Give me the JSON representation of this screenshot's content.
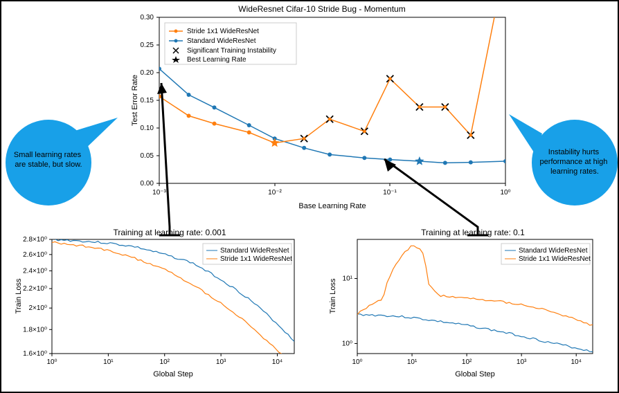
{
  "main": {
    "title": "WideResnet Cifar-10 Stride Bug - Momentum",
    "xlabel": "Base Learning Rate",
    "ylabel": "Test Error Rate",
    "legend": {
      "s1": "Stride 1x1 WideResNet",
      "s2": "Standard WideResNet",
      "m1": "Significant Training Instability",
      "m2": "Best Learning Rate"
    },
    "yticks": [
      "0.00",
      "0.05",
      "0.10",
      "0.15",
      "0.20",
      "0.25",
      "0.30"
    ],
    "xticks": [
      "10⁻³",
      "10⁻²",
      "10⁻¹",
      "10⁰"
    ]
  },
  "bl": {
    "title": "Training at learning rate: 0.001",
    "xlabel": "Global Step",
    "ylabel": "Train Loss",
    "legend": {
      "s1": "Standard WideResNet",
      "s2": "Stride 1x1 WideResNet"
    },
    "xticks": [
      "10⁰",
      "10¹",
      "10²",
      "10³",
      "10⁴"
    ],
    "yticks": [
      "1.6×10⁰",
      "1.8×10⁰",
      "2×10⁰",
      "2.2×10⁰",
      "2.4×10⁰",
      "2.6×10⁰",
      "2.8×10⁰"
    ]
  },
  "br": {
    "title": "Training at learning rate: 0.1",
    "xlabel": "Global Step",
    "ylabel": "Train Loss",
    "legend": {
      "s1": "Standard WideResNet",
      "s2": "Stride 1x1 WideResNet"
    },
    "xticks": [
      "10⁰",
      "10¹",
      "10²",
      "10³",
      "10⁴"
    ],
    "yticks": [
      "10⁰",
      "10¹"
    ]
  },
  "ann": {
    "left": "Small learning rates\nare stable, but slow.",
    "right": "Instability hurts\nperformance at high\nlearning rates."
  },
  "chart_data": [
    {
      "type": "line",
      "id": "main",
      "title": "WideResnet Cifar-10 Stride Bug - Momentum",
      "xlabel": "Base Learning Rate",
      "ylabel": "Test Error Rate",
      "xscale": "log",
      "xlim": [
        0.001,
        1.0
      ],
      "ylim": [
        0.0,
        0.3
      ],
      "x": [
        0.001,
        0.0018,
        0.003,
        0.006,
        0.01,
        0.018,
        0.03,
        0.06,
        0.1,
        0.18,
        0.3,
        0.5,
        1.0
      ],
      "series": [
        {
          "name": "Stride 1x1 WideResNet",
          "values": [
            0.157,
            0.122,
            0.108,
            0.092,
            0.073,
            0.081,
            0.116,
            0.094,
            0.189,
            0.138,
            0.138,
            0.087,
            0.4
          ],
          "color": "#ff7f0e",
          "markers": [
            "dot",
            "dot",
            "dot",
            "dot",
            "star",
            "x",
            "x",
            "x",
            "x",
            "x",
            "x",
            "x",
            "off"
          ]
        },
        {
          "name": "Standard WideResNet",
          "values": [
            0.207,
            0.16,
            0.137,
            0.105,
            0.081,
            0.064,
            0.052,
            0.046,
            0.043,
            0.04,
            0.037,
            0.038,
            0.04
          ],
          "color": "#1f77b4",
          "markers": [
            "dot",
            "dot",
            "dot",
            "dot",
            "dot",
            "dot",
            "dot",
            "dot",
            "dot",
            "star",
            "dot",
            "dot",
            "dot"
          ]
        }
      ],
      "annotations": [
        "X = Significant Training Instability",
        "★ = Best Learning Rate"
      ]
    },
    {
      "type": "line",
      "id": "bottom_left",
      "title": "Training at learning rate: 0.001",
      "xlabel": "Global Step",
      "ylabel": "Train Loss",
      "xscale": "log",
      "yscale": "log",
      "xlim": [
        1,
        20000
      ],
      "ylim": [
        1.6,
        2.8
      ],
      "x": [
        1,
        3,
        10,
        30,
        100,
        300,
        1000,
        3000,
        10000,
        20000
      ],
      "series": [
        {
          "name": "Standard WideResNet",
          "values": [
            2.8,
            2.78,
            2.75,
            2.7,
            2.6,
            2.5,
            2.3,
            2.1,
            1.85,
            1.7
          ],
          "color": "#1f77b4"
        },
        {
          "name": "Stride 1x1 WideResNet",
          "values": [
            2.76,
            2.72,
            2.65,
            2.55,
            2.42,
            2.25,
            2.05,
            1.85,
            1.62,
            1.52
          ],
          "color": "#ff7f0e"
        }
      ]
    },
    {
      "type": "line",
      "id": "bottom_right",
      "title": "Training at learning rate: 0.1",
      "xlabel": "Global Step",
      "ylabel": "Train Loss",
      "xscale": "log",
      "yscale": "log",
      "xlim": [
        1,
        20000
      ],
      "ylim": [
        0.7,
        40
      ],
      "x": [
        1,
        3,
        6,
        10,
        15,
        20,
        30,
        100,
        300,
        1000,
        3000,
        10000,
        20000
      ],
      "series": [
        {
          "name": "Standard WideResNet",
          "values": [
            2.8,
            2.7,
            2.6,
            2.5,
            2.4,
            2.3,
            2.2,
            1.9,
            1.6,
            1.3,
            1.05,
            0.85,
            0.75
          ],
          "color": "#1f77b4"
        },
        {
          "name": "Stride 1x1 WideResNet",
          "values": [
            2.8,
            5.0,
            20,
            32,
            28,
            8,
            5.5,
            5.0,
            4.6,
            4.0,
            3.2,
            2.3,
            1.9
          ],
          "color": "#ff7f0e"
        }
      ]
    }
  ]
}
